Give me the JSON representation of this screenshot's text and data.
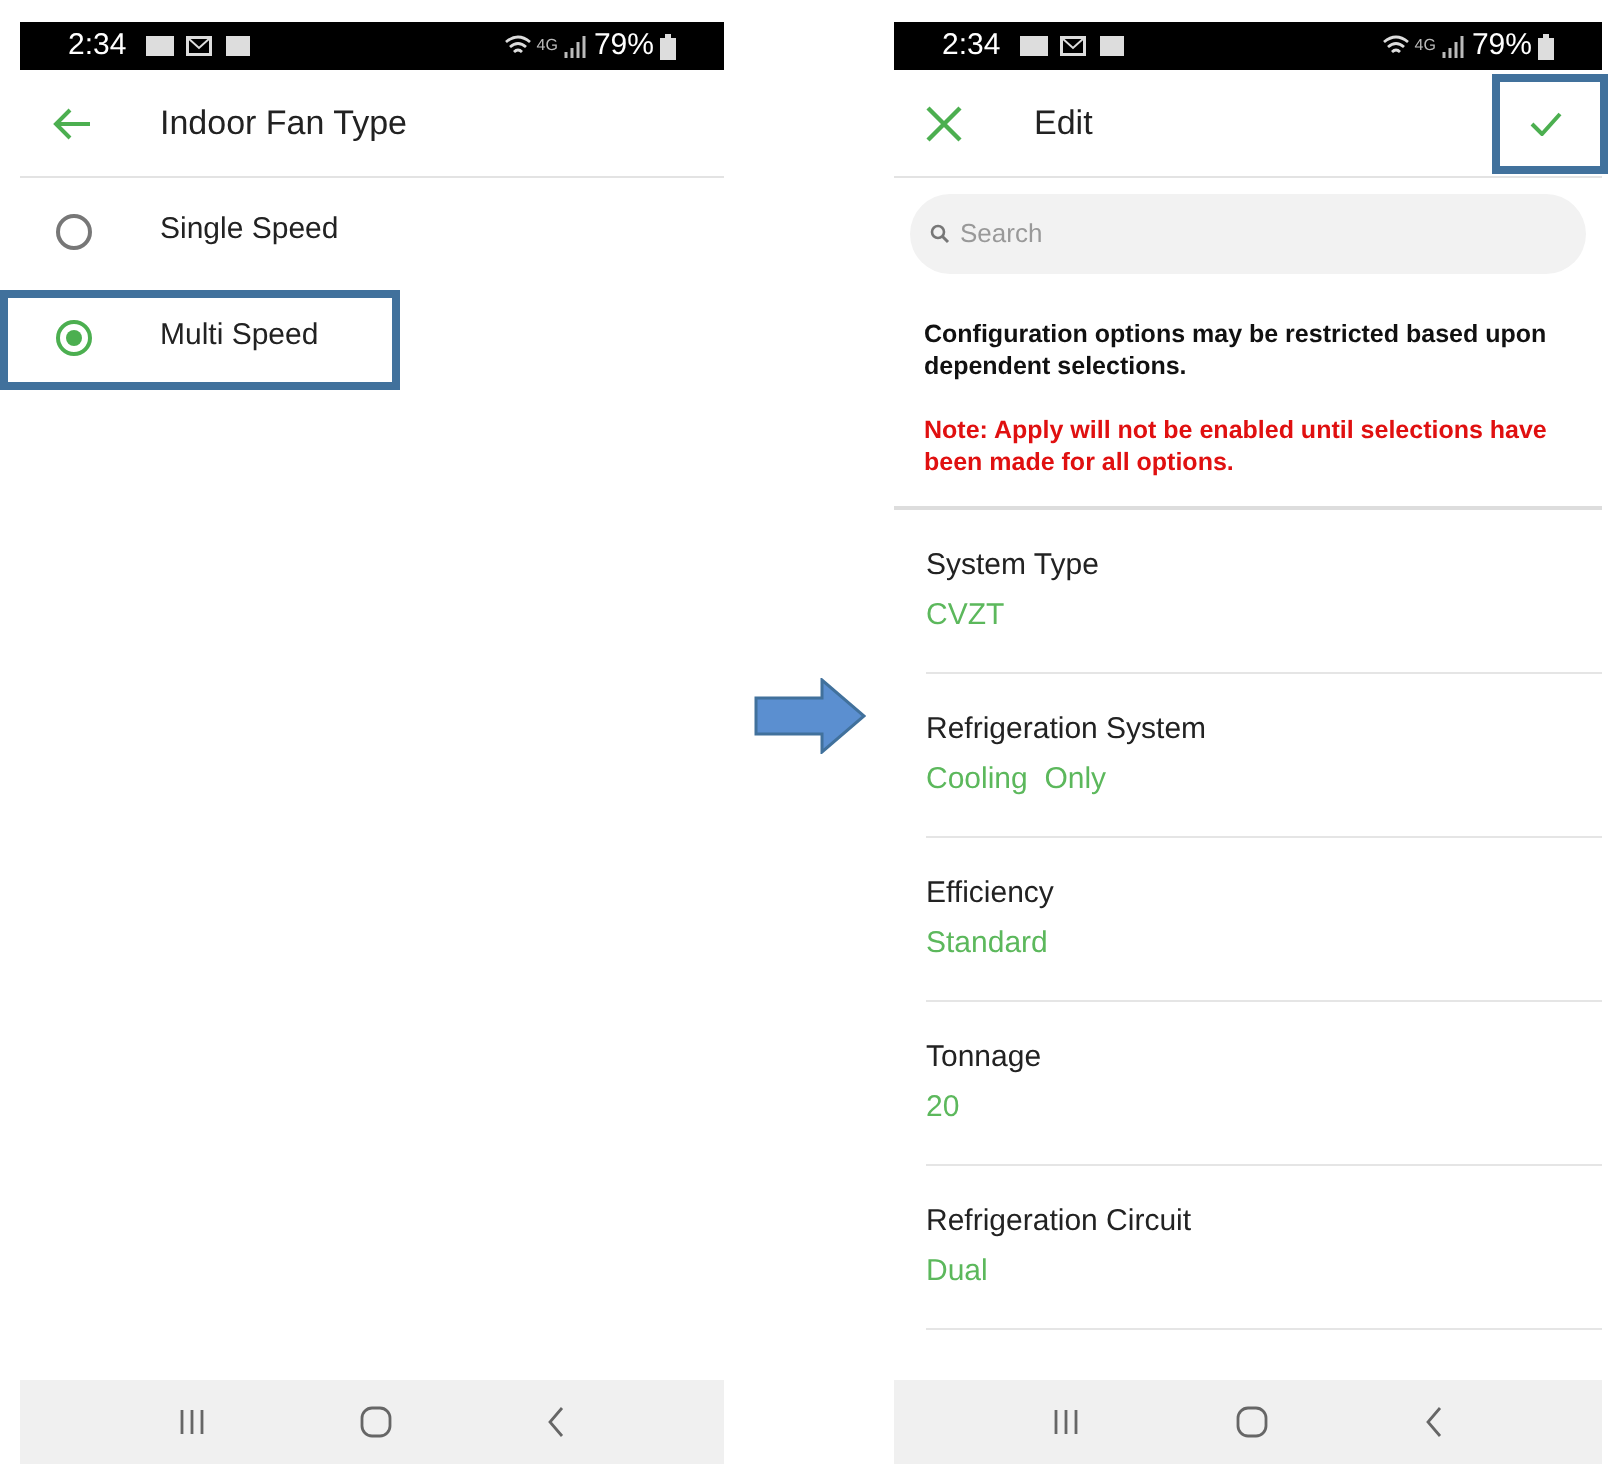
{
  "screens": [
    {
      "status_bar": {
        "time": "2:34",
        "network": "4G",
        "battery": "79%"
      },
      "header": {
        "kind": "back",
        "title": "Indoor Fan Type",
        "confirm": false,
        "confirm_highlighted": false
      },
      "options": [
        {
          "label": "Single Speed",
          "selected": false,
          "highlighted": false
        },
        {
          "label": "Multi Speed",
          "selected": true,
          "highlighted": true
        }
      ]
    },
    {
      "status_bar": {
        "time": "2:34",
        "network": "4G",
        "battery": "79%"
      },
      "header": {
        "kind": "close",
        "title": "Edit",
        "confirm": true,
        "confirm_highlighted": true
      },
      "search": {
        "placeholder": "Search"
      },
      "info": "Configuration options may be restricted based upon dependent selections.",
      "note": "Note: Apply will not be enabled until selections have been made for all options.",
      "settings": [
        {
          "label": "System Type",
          "value": "CVZT"
        },
        {
          "label": "Refrigeration System",
          "value": "Cooling  Only"
        },
        {
          "label": "Efficiency",
          "value": "Standard"
        },
        {
          "label": "Tonnage",
          "value": "20"
        },
        {
          "label": "Refrigeration Circuit",
          "value": "Dual"
        }
      ]
    }
  ]
}
